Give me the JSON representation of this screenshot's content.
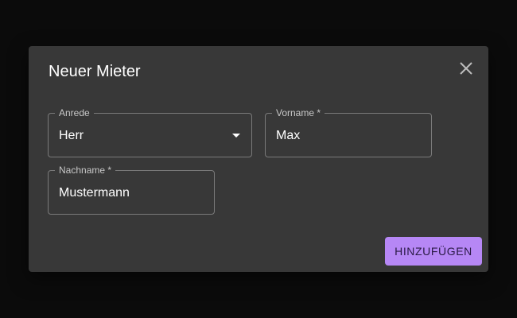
{
  "dialog": {
    "title": "Neuer Mieter",
    "close_icon": "close-icon"
  },
  "fields": {
    "anrede": {
      "label": "Anrede",
      "value": "Herr",
      "icon": "dropdown-arrow-icon"
    },
    "vorname": {
      "label": "Vorname *",
      "value": "Max"
    },
    "nachname": {
      "label": "Nachname *",
      "value": "Mustermann"
    }
  },
  "actions": {
    "submit_label": "HINZUFÜGEN"
  },
  "colors": {
    "backdrop": "#0b0b0b",
    "dialog": "#383838",
    "accent": "#b687f5"
  }
}
